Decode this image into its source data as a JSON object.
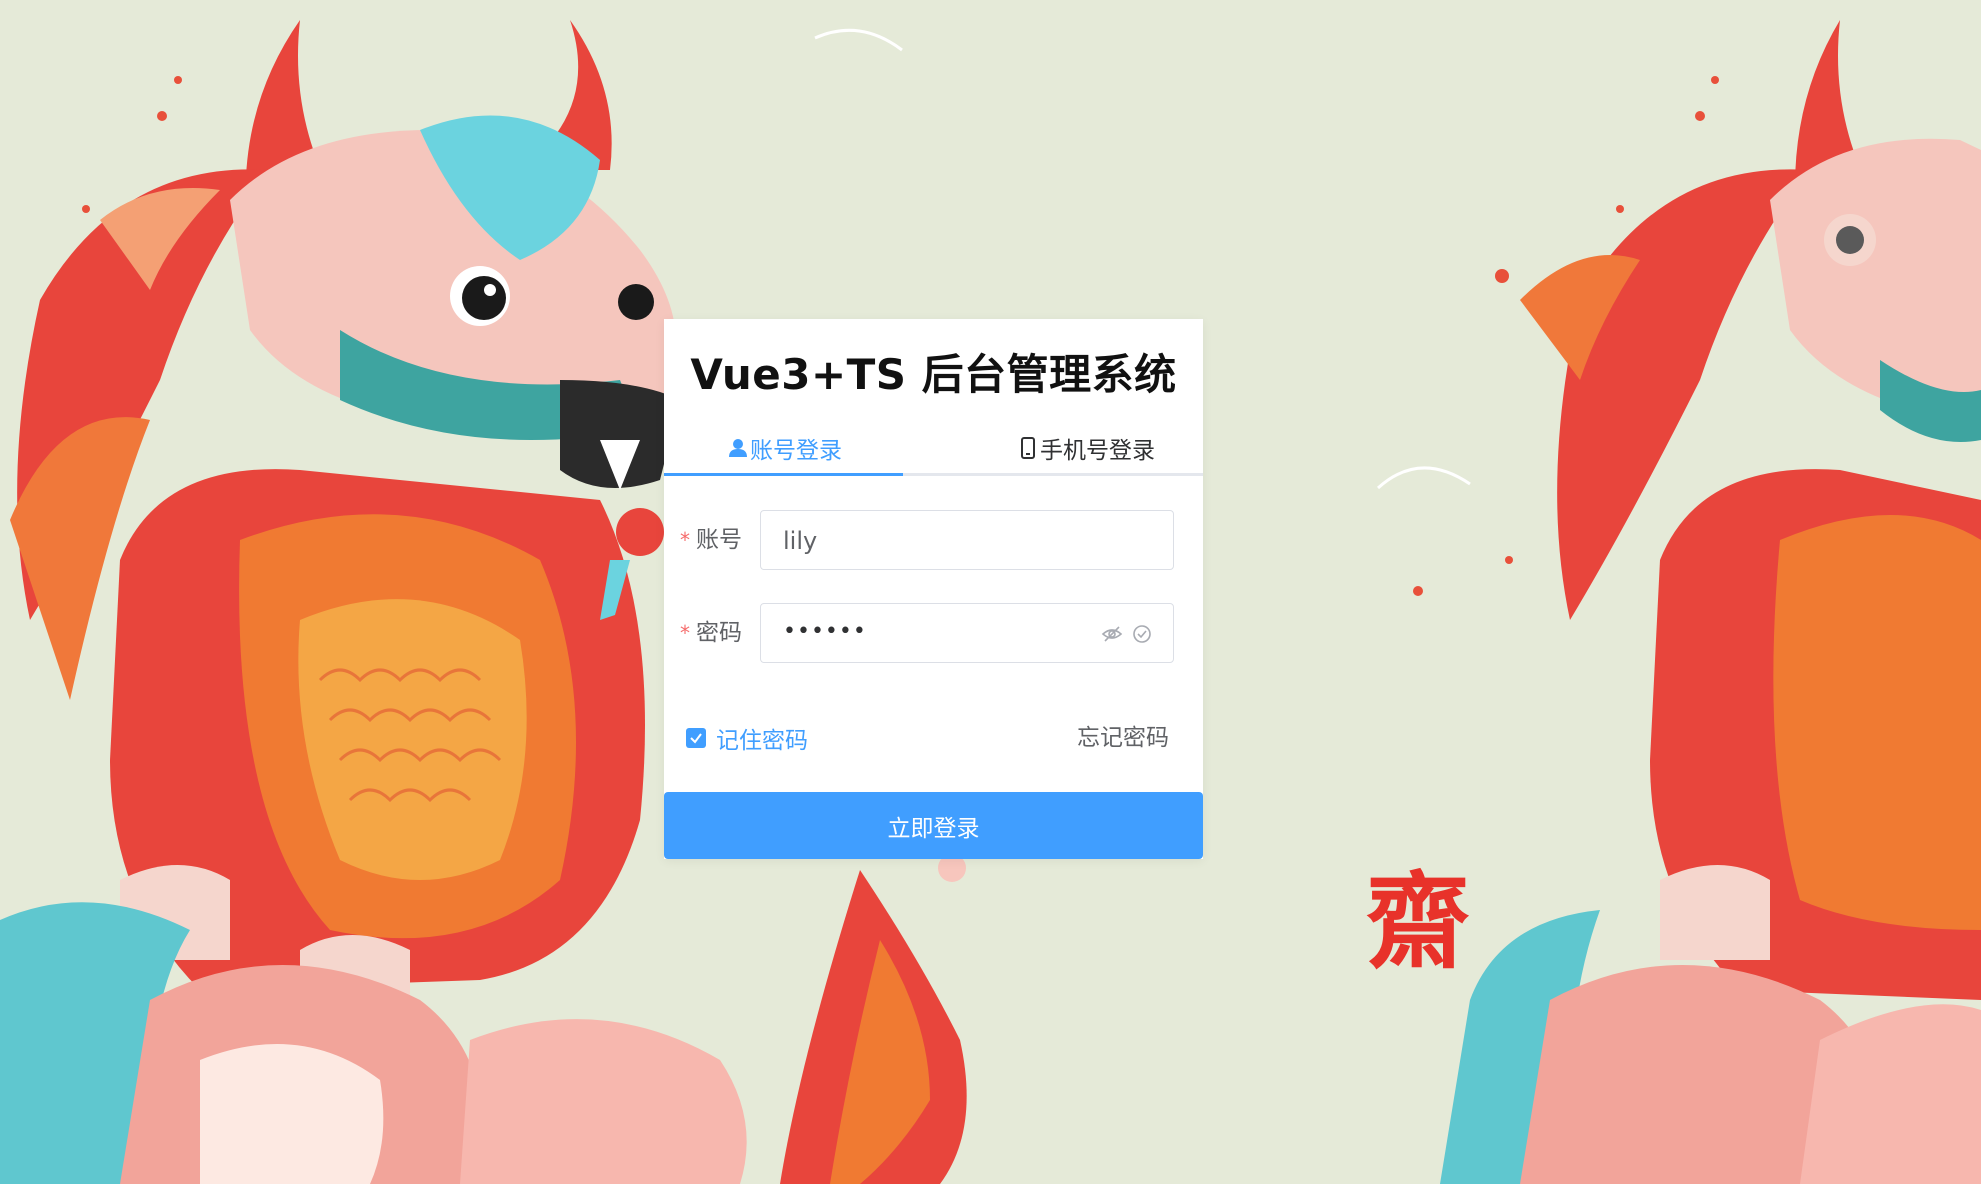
{
  "title": "Vue3+TS 后台管理系统",
  "tabs": [
    {
      "label": "账号登录",
      "icon": "user-icon",
      "active": true
    },
    {
      "label": "手机号登录",
      "icon": "mobile-phone-icon",
      "active": false
    }
  ],
  "account": {
    "label": "账号",
    "value": "lily",
    "required": true
  },
  "password": {
    "label": "密码",
    "masked_value": "••••••",
    "required": true
  },
  "remember": {
    "label": "记住密码",
    "checked": true
  },
  "forgot_label": "忘记密码",
  "submit_label": "立即登录",
  "decoration": {
    "seal_char": "齋"
  },
  "colors": {
    "accent": "#409eff",
    "background": "#e5ead8",
    "required": "#f56c6c"
  }
}
